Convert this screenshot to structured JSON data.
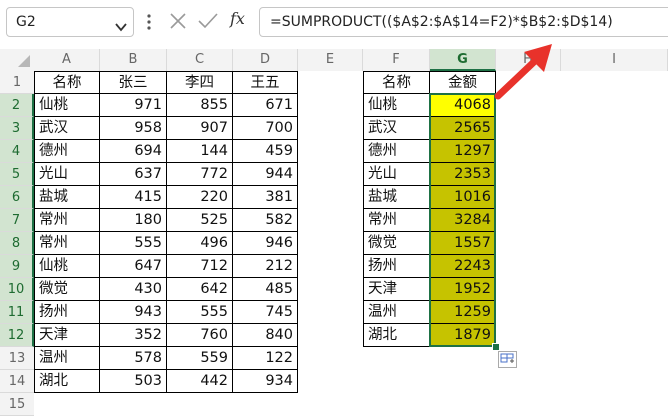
{
  "formula_bar": {
    "name_box": "G2",
    "formula": "=SUMPRODUCT(($A$2:$A$14=F2)*$B$2:$D$14)",
    "fx_label": "fx"
  },
  "columns": [
    "A",
    "B",
    "C",
    "D",
    "E",
    "F",
    "G",
    "H",
    "I"
  ],
  "rows": [
    "1",
    "2",
    "3",
    "4",
    "5",
    "6",
    "7",
    "8",
    "9",
    "10",
    "11",
    "12",
    "13",
    "14",
    "15"
  ],
  "table1": {
    "headers": [
      "名称",
      "张三",
      "李四",
      "王五"
    ],
    "rows": [
      [
        "仙桃",
        "971",
        "855",
        "671"
      ],
      [
        "武汉",
        "958",
        "907",
        "700"
      ],
      [
        "德州",
        "694",
        "144",
        "459"
      ],
      [
        "光山",
        "637",
        "772",
        "944"
      ],
      [
        "盐城",
        "415",
        "220",
        "381"
      ],
      [
        "常州",
        "180",
        "525",
        "582"
      ],
      [
        "常州",
        "555",
        "496",
        "946"
      ],
      [
        "仙桃",
        "647",
        "712",
        "212"
      ],
      [
        "微觉",
        "430",
        "642",
        "485"
      ],
      [
        "扬州",
        "943",
        "555",
        "745"
      ],
      [
        "天津",
        "352",
        "760",
        "840"
      ],
      [
        "温州",
        "578",
        "559",
        "122"
      ],
      [
        "湖北",
        "503",
        "442",
        "934"
      ]
    ]
  },
  "table2": {
    "headers": [
      "名称",
      "金额"
    ],
    "rows": [
      [
        "仙桃",
        "4068"
      ],
      [
        "武汉",
        "2565"
      ],
      [
        "德州",
        "1297"
      ],
      [
        "光山",
        "2353"
      ],
      [
        "盐城",
        "1016"
      ],
      [
        "常州",
        "3284"
      ],
      [
        "微觉",
        "1557"
      ],
      [
        "扬州",
        "2243"
      ],
      [
        "天津",
        "1952"
      ],
      [
        "温州",
        "1259"
      ],
      [
        "湖北",
        "1879"
      ]
    ]
  },
  "colors": {
    "selected_cell_fill": "#ffff00",
    "range_fill": "#c6c300",
    "arrow": "#e8322b",
    "selection_border": "#1e7145"
  },
  "icons": [
    "chevron-down-icon",
    "more-options-icon",
    "cancel-icon",
    "confirm-icon",
    "insert-function-icon",
    "arrow-annotation-icon",
    "quick-analysis-icon"
  ]
}
